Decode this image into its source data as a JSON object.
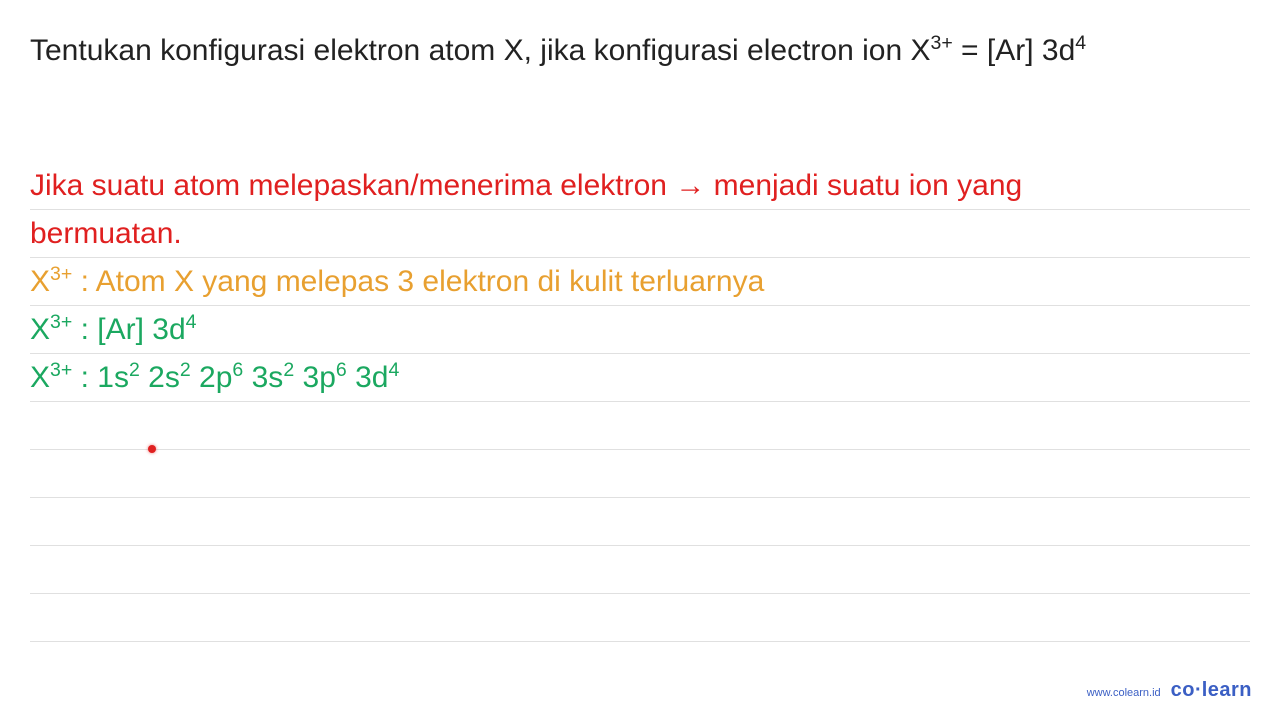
{
  "question": {
    "prefix": "Tentukan konfigurasi elektron atom X, jika konfigurasi electron ion X",
    "ion_sup": "3+",
    "mid": " = [Ar] 3d",
    "end_sup": "4"
  },
  "lines": {
    "red1": "Jika suatu atom melepaskan/menerima elektron ",
    "arrow": "→",
    "red1b": " menjadi suatu ion yang",
    "red2": "bermuatan.",
    "orange_pre": "X",
    "orange_sup": "3+",
    "orange_rest": " : Atom X yang melepas 3 elektron di kulit terluarnya",
    "green1_pre": "X",
    "green1_sup": "3+",
    "green1_mid": " : [Ar] 3d",
    "green1_sup2": "4",
    "green2_pre": "X",
    "green2_sup": "3+",
    "green2_s1": " : 1s",
    "green2_e1": "2",
    "green2_s2": " 2s",
    "green2_e2": "2",
    "green2_s3": " 2p",
    "green2_e3": "6",
    "green2_s4": " 3s",
    "green2_e4": "2",
    "green2_s5": " 3p",
    "green2_e5": "6",
    "green2_s6": " 3d",
    "green2_e6": "4"
  },
  "footer": {
    "url": "www.colearn.id",
    "logo_pre": "co",
    "logo_dot": "·",
    "logo_post": "learn"
  }
}
